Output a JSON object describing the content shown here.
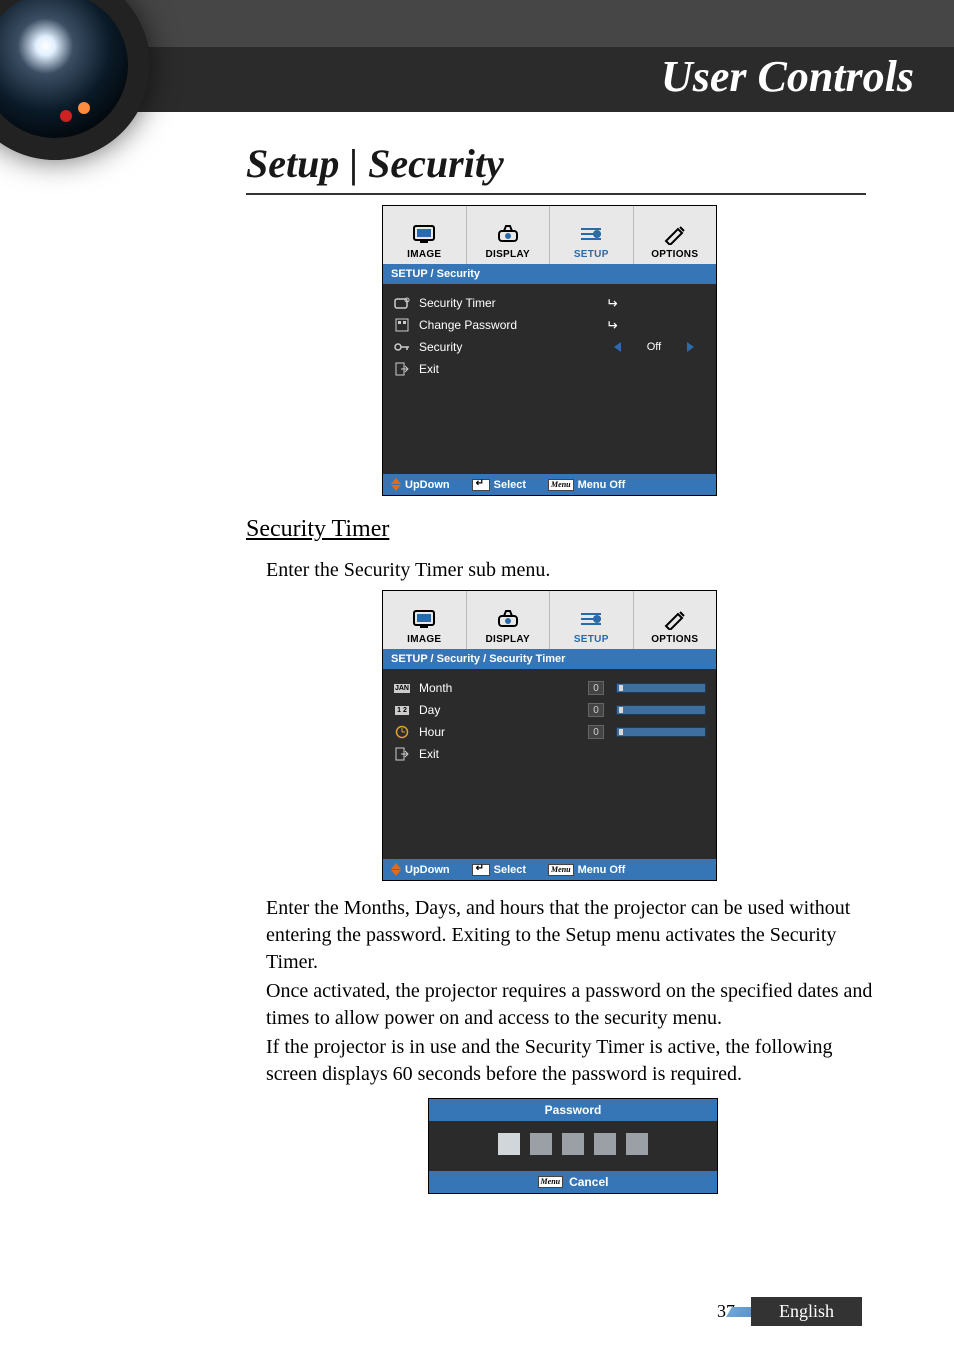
{
  "banner": {
    "title": "User Controls"
  },
  "section_heading": "Setup | Security",
  "osd1": {
    "tabs": [
      "IMAGE",
      "DISPLAY",
      "SETUP",
      "OPTIONS"
    ],
    "breadcrumb": "SETUP / Security",
    "rows": {
      "security_timer": "Security Timer",
      "change_password": "Change Password",
      "security": "Security",
      "security_value": "Off",
      "exit": "Exit"
    },
    "footer": {
      "updown": "UpDown",
      "select": "Select",
      "menu_off": "Menu Off"
    }
  },
  "sub_heading": "Security Timer",
  "para1": "Enter the Security Timer sub menu.",
  "osd2": {
    "tabs": [
      "IMAGE",
      "DISPLAY",
      "SETUP",
      "OPTIONS"
    ],
    "breadcrumb": "SETUP / Security / Security Timer",
    "rows": {
      "month": "Month",
      "month_val": "0",
      "day": "Day",
      "day_val": "0",
      "hour": "Hour",
      "hour_val": "0",
      "exit": "Exit",
      "month_badge": "JAN",
      "day_badge": "1 2"
    },
    "footer": {
      "updown": "UpDown",
      "select": "Select",
      "menu_off": "Menu Off"
    }
  },
  "para2": "Enter the Months, Days, and hours that the projector can be used without entering the password. Exiting to the Setup menu activates the Security Timer.",
  "para3": "Once activated, the projector requires a password on the specified dates and times to allow power on and access to the security menu.",
  "para4": "If the projector is in use and the Security Timer is active, the following screen displays 60 seconds before the password is required.",
  "password_panel": {
    "title": "Password",
    "cancel": "Cancel",
    "menu_badge": "Menu"
  },
  "footer": {
    "page": "37",
    "language": "English",
    "menu_badge": "Menu"
  }
}
